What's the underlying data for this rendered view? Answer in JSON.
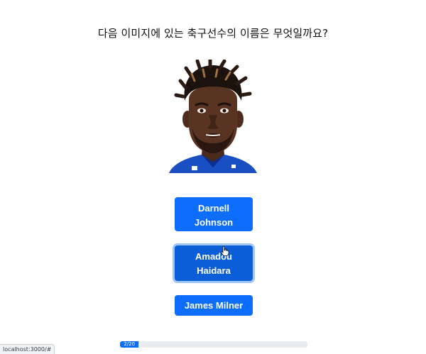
{
  "quiz": {
    "question": "다음 이미지에 있는 축구선수의 이름은 무엇일까요?",
    "image": {
      "subject": "player-portrait"
    },
    "answers": [
      {
        "label": "Darnell Johnson",
        "state": "default"
      },
      {
        "label": "Amadou Haidara",
        "state": "hover"
      },
      {
        "label": "James Milner",
        "state": "default"
      }
    ],
    "progress": {
      "label": "2/20",
      "current": 2,
      "total": 20,
      "fraction": 0.1
    }
  },
  "browser": {
    "status_url": "localhost:3000/#"
  },
  "colors": {
    "primary": "#0d6efd",
    "primary_hover": "#0b5ed7",
    "focus_ring": "#9ec5fe",
    "track": "#e9ecef"
  }
}
